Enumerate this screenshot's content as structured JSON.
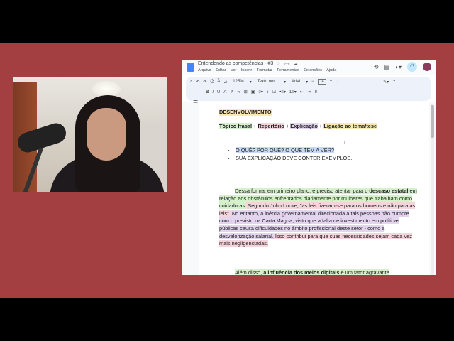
{
  "doc": {
    "title": "Entendendo as competências - #3",
    "menu": [
      "Arquivo",
      "Editar",
      "Ver",
      "Inserir",
      "Formatar",
      "Ferramentas",
      "Extensões",
      "Ajuda"
    ]
  },
  "toolbar": {
    "zoom": "125%",
    "style": "Texto nor...",
    "font": "Arial",
    "font_size": "14"
  },
  "content": {
    "heading": "DESENVOLVIMENTO",
    "topics": [
      "Tópico frasal",
      "Repertório",
      "Explicação",
      "Ligação ao tema/tese"
    ],
    "plus": "+",
    "bullets": [
      "O QUÊ? POR QUÊ? O QUE TEM A VER?",
      "SUA EXPLICAÇÃO DEVE CONTER EXEMPLOS."
    ],
    "para1": {
      "s1": "Dessa forma, em primeiro plano, é preciso atentar para o ",
      "s2": "descaso estatal",
      "s3": " em relação aos obstáculos enfrentados diariamente por mulheres que trabalham como cuidadoras.",
      "s4": " Segundo John Locke, \"as leis fizeram-se para os homens e não para as leis\".",
      "s5": " No entanto, a inércia governamental direcionada a tais pessoas não cumpre com o previsto na Carta Magna, visto que a falta de investimento em políticas públicas causa dificuldades no âmbito profissional deste setor - como a desvalorização salarial.",
      "s6": " Isso contribui para que suas necessidades sejam cada vez mais negligenciadas."
    },
    "para2": {
      "s1": "Além disso, ",
      "s2": "a influência dos meios digitais",
      "s3": " é um fator agravante"
    }
  },
  "colors": {
    "background": "#a33f40",
    "highlight_green": "#d7f0cc",
    "highlight_pink": "#f6d4dc",
    "highlight_yellow": "#fce8b2",
    "highlight_purple": "#e4d5ef",
    "highlight_blue": "#c8daf8"
  }
}
